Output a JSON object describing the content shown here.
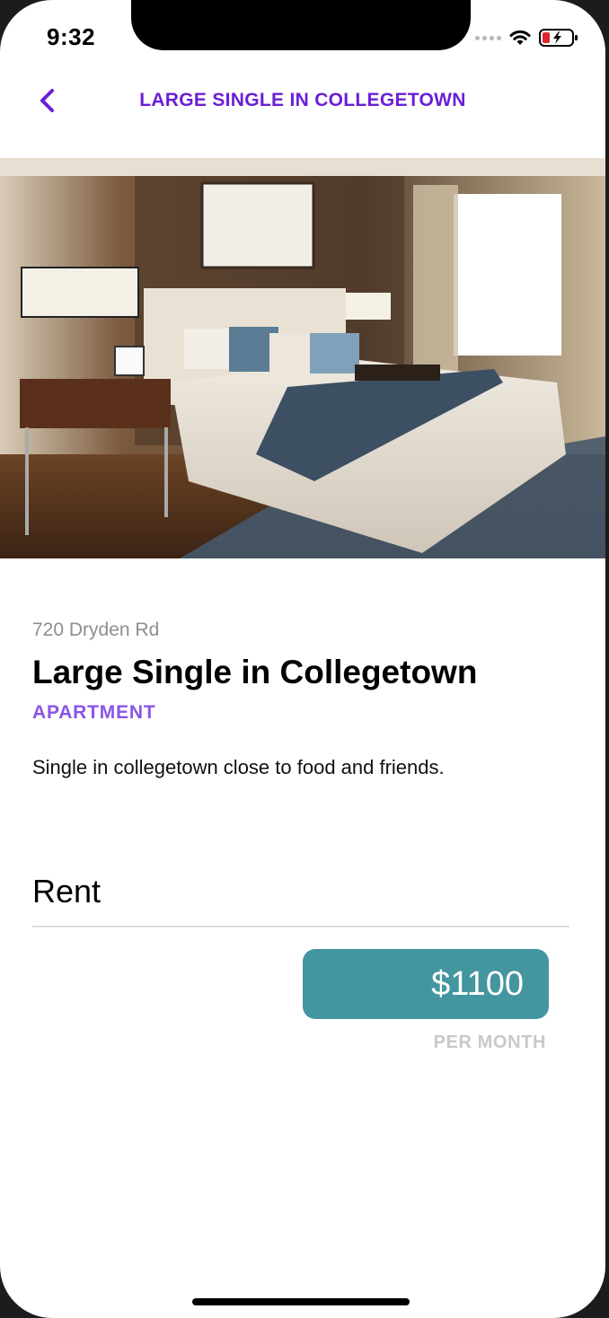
{
  "status_bar": {
    "time": "9:32"
  },
  "nav": {
    "title": "LARGE SINGLE IN COLLEGETOWN"
  },
  "listing": {
    "address": "720 Dryden Rd",
    "title": "Large Single in Collegetown",
    "type": "APARTMENT",
    "description": "Single in collegetown close to food and friends."
  },
  "rent": {
    "label": "Rent",
    "price": "$1100",
    "period": "PER MONTH"
  },
  "colors": {
    "accent": "#6a1fd6",
    "type_label": "#8a55e6",
    "price_box": "#43959f"
  }
}
